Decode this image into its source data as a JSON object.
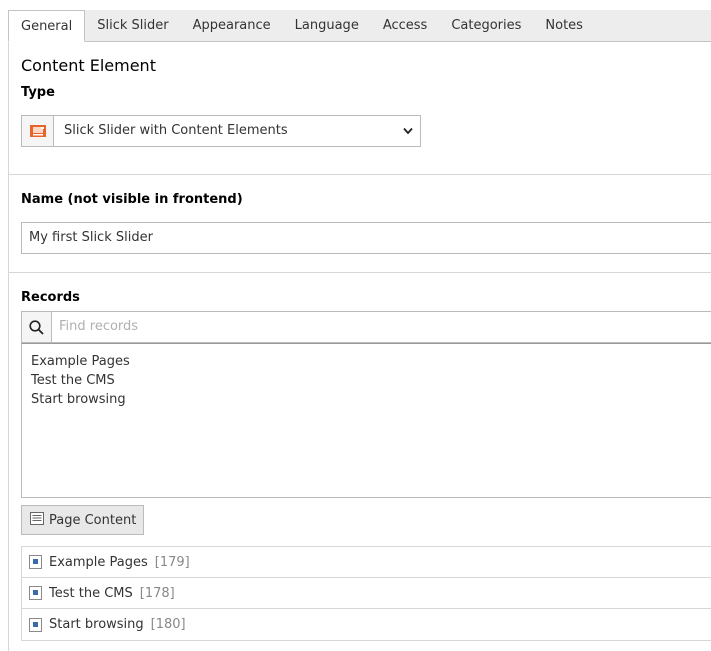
{
  "tabs": [
    {
      "label": "General"
    },
    {
      "label": "Slick Slider"
    },
    {
      "label": "Appearance"
    },
    {
      "label": "Language"
    },
    {
      "label": "Access"
    },
    {
      "label": "Categories"
    },
    {
      "label": "Notes"
    }
  ],
  "section_title": "Content Element",
  "type_field": {
    "label": "Type",
    "selected": "Slick Slider with Content Elements",
    "icon": "slider-content-type-icon"
  },
  "name_field": {
    "label": "Name (not visible in frontend)",
    "value": "My first Slick Slider"
  },
  "records": {
    "label": "Records",
    "search_placeholder": "Find records",
    "items": [
      "Example Pages",
      "Test the CMS",
      "Start browsing"
    ],
    "add_button_label": "Page Content",
    "selected": [
      {
        "title": "Example Pages",
        "uid": "[179]"
      },
      {
        "title": "Test the CMS",
        "uid": "[178]"
      },
      {
        "title": "Start browsing",
        "uid": "[180]"
      }
    ]
  },
  "colors": {
    "tab_bar_bg": "#ededed",
    "border": "#bbbbbb",
    "icon_accent": "#e8642a"
  }
}
